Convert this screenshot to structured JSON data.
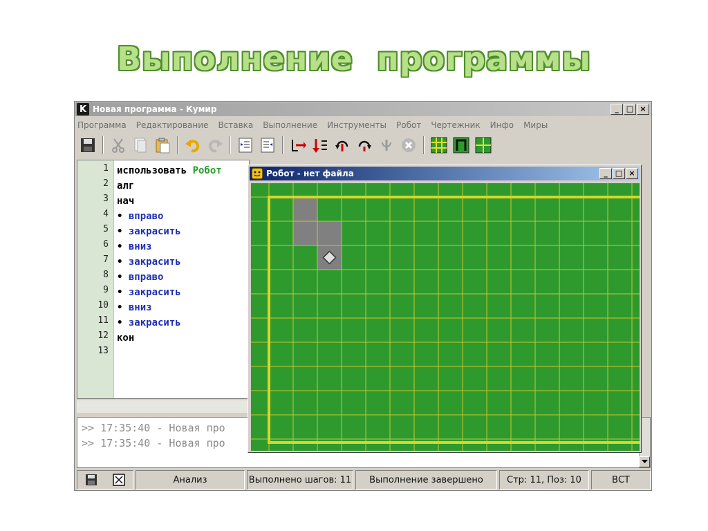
{
  "slide": {
    "title": "Выполнение  программы"
  },
  "window": {
    "icon_letter": "K",
    "title": "Новая программа - Кумир",
    "controls": {
      "minimize": "_",
      "maximize": "□",
      "close": "×"
    }
  },
  "menu": [
    "Программа",
    "Редактирование",
    "Вставка",
    "Выполнение",
    "Инструменты",
    "Робот",
    "Чертежник",
    "Инфо",
    "Миры"
  ],
  "toolbar": {
    "icons": [
      "save-icon",
      "cut-icon",
      "copy-icon",
      "paste-icon",
      "undo-icon",
      "redo-icon",
      "indent-icon",
      "unindent-icon",
      "run-icon",
      "step-icon",
      "step-into-icon",
      "step-over-icon",
      "step-out-icon",
      "stop-icon",
      "robot-field-icon",
      "drawer-icon",
      "windows-icon"
    ]
  },
  "editor": {
    "lines": [
      {
        "n": "1",
        "parts": [
          {
            "t": "использовать ",
            "c": "kw"
          },
          {
            "t": "Робот",
            "c": "ident"
          }
        ]
      },
      {
        "n": "2",
        "parts": [
          {
            "t": "алг",
            "c": "kw"
          }
        ]
      },
      {
        "n": "3",
        "parts": [
          {
            "t": "нач",
            "c": "kw"
          }
        ]
      },
      {
        "n": "4",
        "parts": [
          {
            "t": "• ",
            "c": "bullet"
          },
          {
            "t": "вправо",
            "c": "cmd"
          }
        ]
      },
      {
        "n": "5",
        "parts": [
          {
            "t": "• ",
            "c": "bullet"
          },
          {
            "t": "закрасить",
            "c": "cmd"
          }
        ]
      },
      {
        "n": "6",
        "parts": [
          {
            "t": "• ",
            "c": "bullet"
          },
          {
            "t": "вниз",
            "c": "cmd"
          }
        ]
      },
      {
        "n": "7",
        "parts": [
          {
            "t": "• ",
            "c": "bullet"
          },
          {
            "t": "закрасить",
            "c": "cmd"
          }
        ]
      },
      {
        "n": "8",
        "parts": [
          {
            "t": "• ",
            "c": "bullet"
          },
          {
            "t": "вправо",
            "c": "cmd"
          }
        ]
      },
      {
        "n": "9",
        "parts": [
          {
            "t": "• ",
            "c": "bullet"
          },
          {
            "t": "закрасить",
            "c": "cmd"
          }
        ]
      },
      {
        "n": "10",
        "parts": [
          {
            "t": "• ",
            "c": "bullet"
          },
          {
            "t": "вниз",
            "c": "cmd"
          }
        ]
      },
      {
        "n": "11",
        "parts": [
          {
            "t": "• ",
            "c": "bullet"
          },
          {
            "t": "закрасить",
            "c": "cmd"
          }
        ]
      },
      {
        "n": "12",
        "parts": [
          {
            "t": "кон",
            "c": "kw"
          }
        ]
      },
      {
        "n": "13",
        "parts": []
      }
    ]
  },
  "console": {
    "lines": [
      ">> 17:35:40 - Новая про",
      ">> 17:35:40 - Новая про"
    ]
  },
  "status": {
    "analysis": "Анализ",
    "steps": "Выполнено шагов: 11",
    "state": "Выполнение завершено",
    "position": "Стр: 11, Поз: 10",
    "mode": "ВСТ"
  },
  "robot_window": {
    "title": "Робот - нет файла",
    "controls": {
      "minimize": "_",
      "maximize": "□",
      "close": "×"
    },
    "field": {
      "cols": 16,
      "rows": 11,
      "painted_cells": [
        [
          1,
          0
        ],
        [
          1,
          1
        ],
        [
          2,
          1
        ],
        [
          2,
          2
        ]
      ],
      "robot": [
        2,
        2
      ],
      "colors": {
        "background": "#2e9a2e",
        "grid": "#c8c830",
        "wall": "#d6d62a",
        "painted": "#808080",
        "robot": "#e0e0e0"
      }
    }
  }
}
